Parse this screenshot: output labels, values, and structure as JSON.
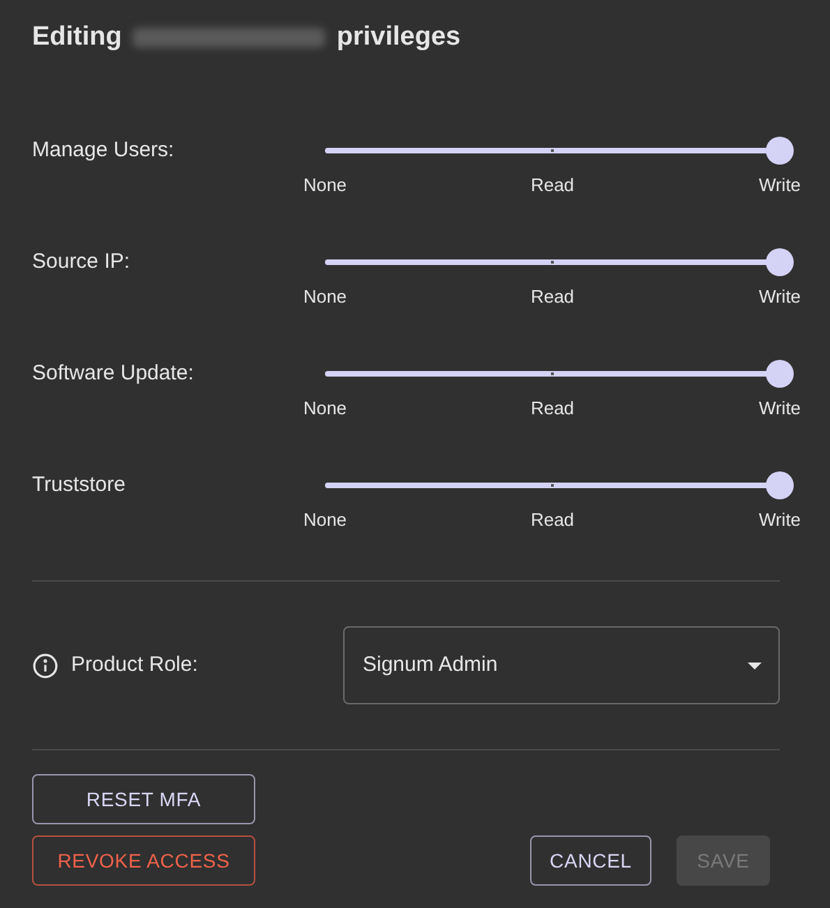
{
  "title": {
    "before": "Editing",
    "after": "privileges",
    "name_redacted": true
  },
  "permissions": [
    {
      "label": "Manage Users:",
      "level": 1,
      "stops": [
        "None",
        "Read",
        "Write"
      ]
    },
    {
      "label": "Source IP:",
      "level": 1,
      "stops": [
        "None",
        "Read",
        "Write"
      ]
    },
    {
      "label": "Software Update:",
      "level": 1,
      "stops": [
        "None",
        "Read",
        "Write"
      ]
    },
    {
      "label": "Truststore",
      "level": 1,
      "stops": [
        "None",
        "Read",
        "Write"
      ]
    }
  ],
  "product_role": {
    "label": "Product Role:",
    "value": "Signum Admin"
  },
  "left_buttons": [
    {
      "label": "RESET MFA",
      "kind": "outlined",
      "disabled": false
    },
    {
      "label": "REVOKE ACCESS",
      "kind": "danger",
      "disabled": false
    }
  ],
  "right_buttons": [
    {
      "label": "CANCEL",
      "kind": "outlined",
      "disabled": false
    },
    {
      "label": "SAVE",
      "kind": "contained",
      "disabled": true
    }
  ]
}
